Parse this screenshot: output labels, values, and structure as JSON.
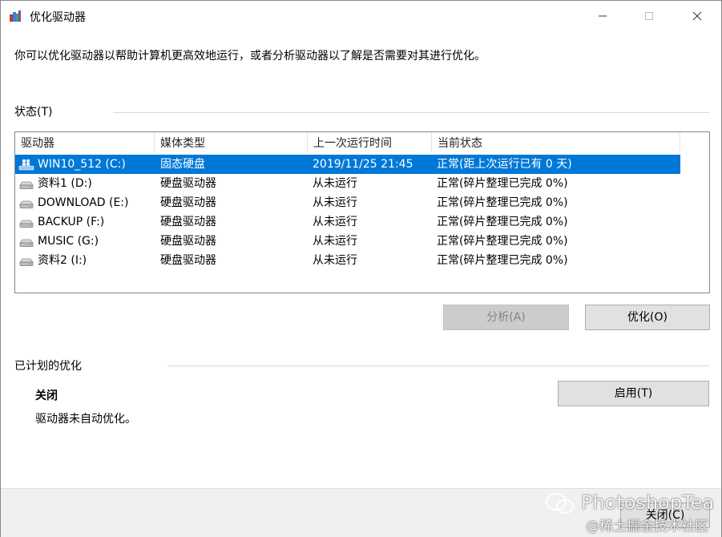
{
  "window": {
    "title": "优化驱动器",
    "description": "你可以优化驱动器以帮助计算机更高效地运行，或者分析驱动器以了解是否需要对其进行优化。"
  },
  "status": {
    "label": "状态(T)",
    "columns": [
      "驱动器",
      "媒体类型",
      "上一次运行时间",
      "当前状态"
    ],
    "drives": [
      {
        "name": "WIN10_512 (C:)",
        "media": "固态硬盘",
        "last_run": "2019/11/25 21:45",
        "state": "正常(距上次运行已有 0 天)",
        "icon": "windows-drive-icon",
        "selected": true
      },
      {
        "name": "资料1 (D:)",
        "media": "硬盘驱动器",
        "last_run": "从未运行",
        "state": "正常(碎片整理已完成 0%)",
        "icon": "hard-drive-icon"
      },
      {
        "name": "DOWNLOAD (E:)",
        "media": "硬盘驱动器",
        "last_run": "从未运行",
        "state": "正常(碎片整理已完成 0%)",
        "icon": "hard-drive-icon"
      },
      {
        "name": "BACKUP (F:)",
        "media": "硬盘驱动器",
        "last_run": "从未运行",
        "state": "正常(碎片整理已完成 0%)",
        "icon": "hard-drive-icon"
      },
      {
        "name": "MUSIC (G:)",
        "media": "硬盘驱动器",
        "last_run": "从未运行",
        "state": "正常(碎片整理已完成 0%)",
        "icon": "hard-drive-icon"
      },
      {
        "name": "资料2 (I:)",
        "media": "硬盘驱动器",
        "last_run": "从未运行",
        "state": "正常(碎片整理已完成 0%)",
        "icon": "hard-drive-icon"
      }
    ]
  },
  "buttons": {
    "analyze": "分析(A)",
    "optimize": "优化(O)",
    "enable": "启用(T)",
    "close": "关闭(C)"
  },
  "scheduled": {
    "label": "已计划的优化",
    "state": "关闭",
    "description": "驱动器未自动优化。"
  },
  "watermark": {
    "brand": "PhotoshopTea",
    "community": "@稀土掘金技术社区"
  },
  "colors": {
    "selection": "#0078d7",
    "button": "#e1e1e1",
    "button_disabled": "#cccccc",
    "footer": "#f0f0f0"
  }
}
